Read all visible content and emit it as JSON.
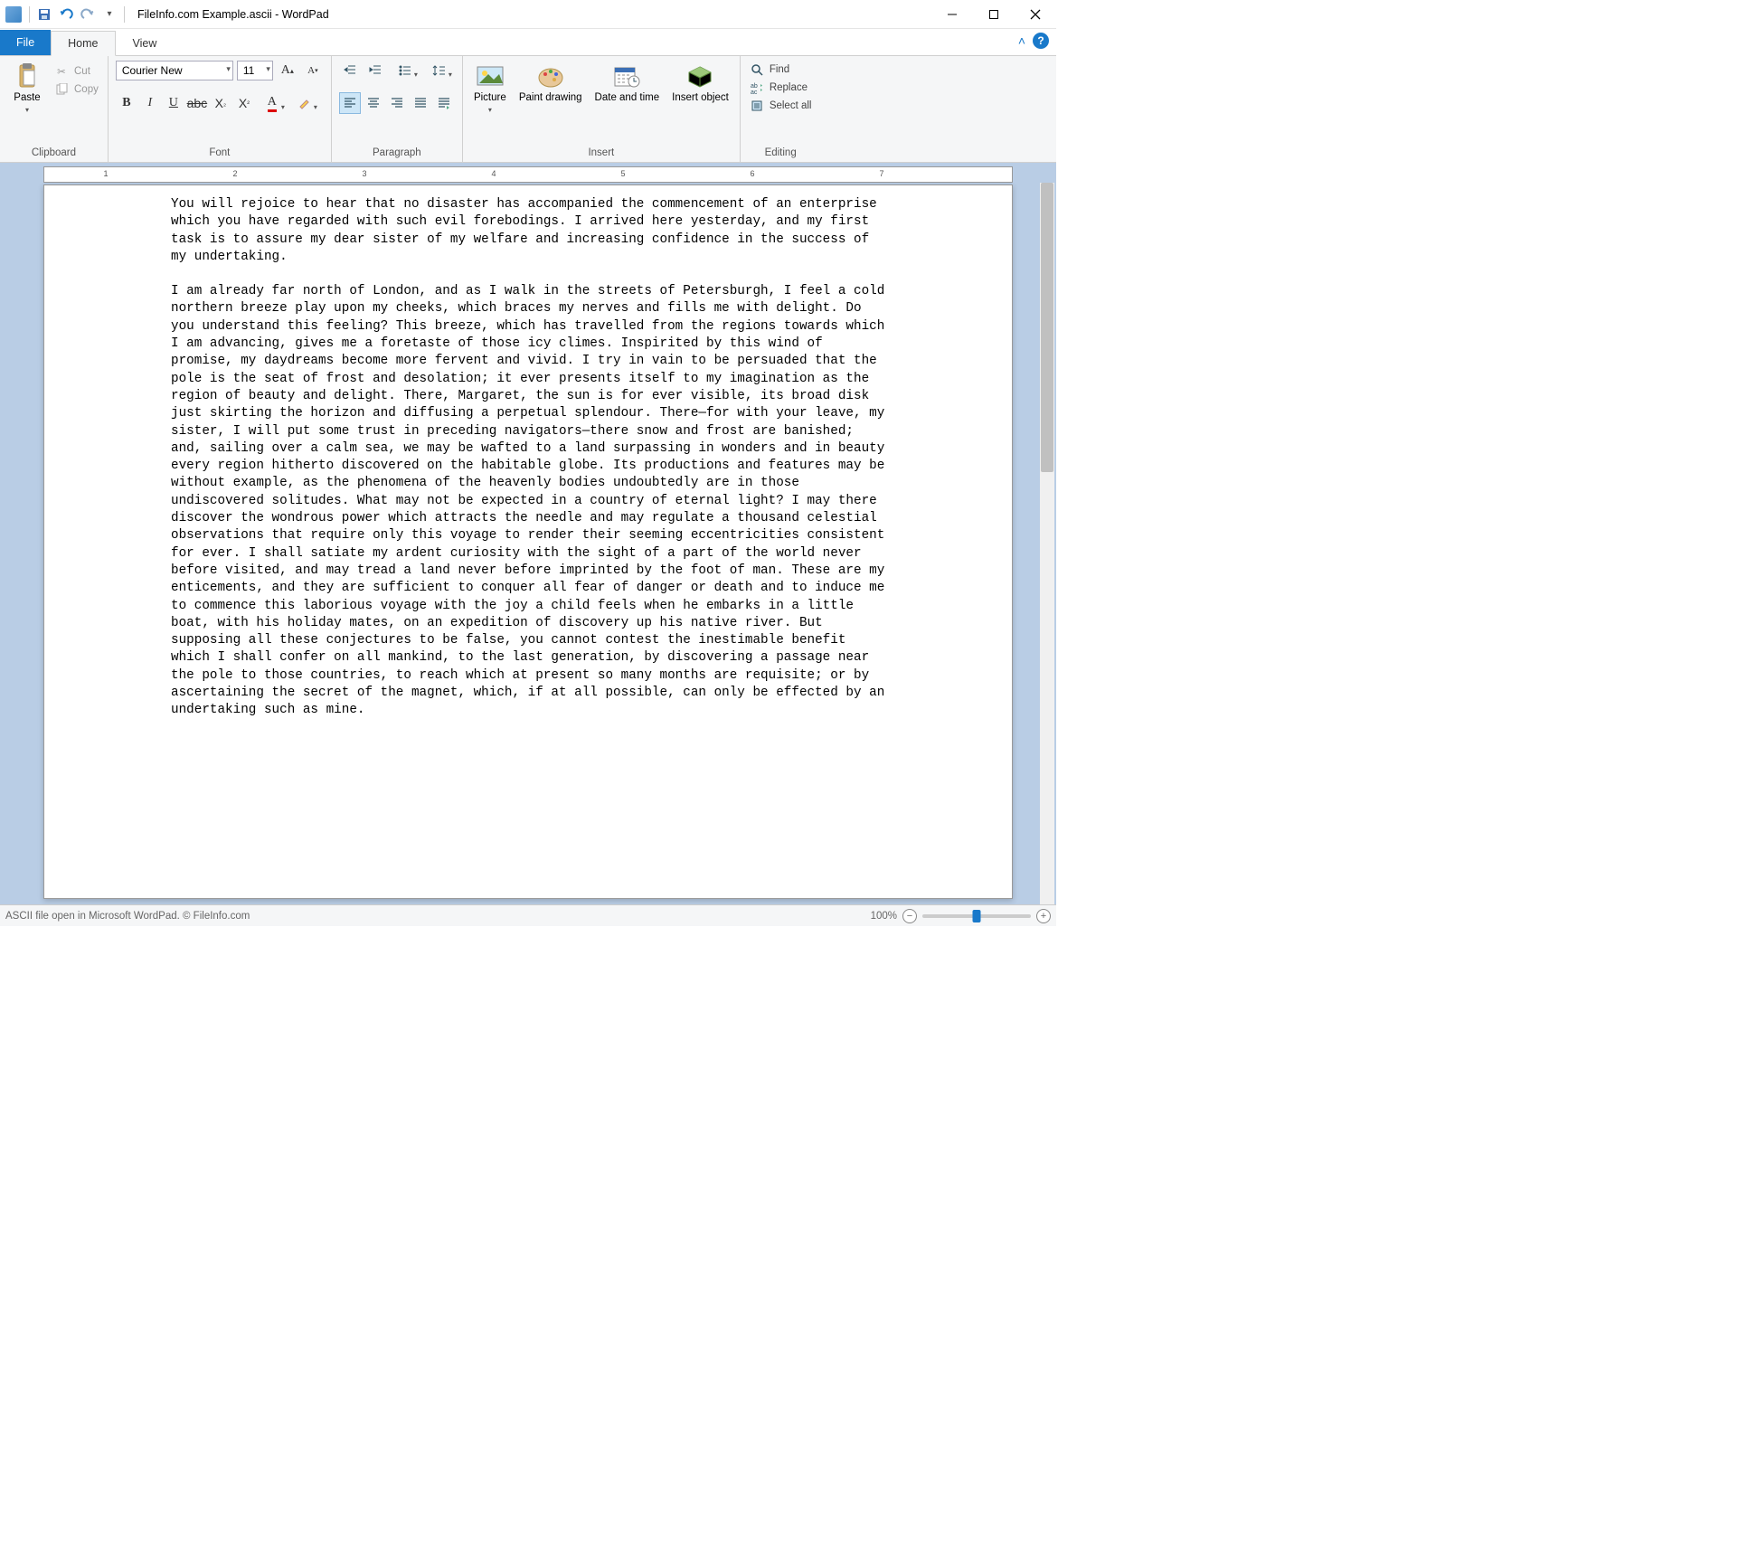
{
  "window": {
    "title": "FileInfo.com Example.ascii - WordPad"
  },
  "qat": {
    "save": "Save",
    "undo": "Undo",
    "redo": "Redo"
  },
  "tabs": {
    "file": "File",
    "home": "Home",
    "view": "View"
  },
  "ribbon": {
    "clipboard": {
      "label": "Clipboard",
      "paste": "Paste",
      "cut": "Cut",
      "copy": "Copy"
    },
    "font": {
      "label": "Font",
      "name": "Courier New",
      "size": "11"
    },
    "paragraph": {
      "label": "Paragraph"
    },
    "insert": {
      "label": "Insert",
      "picture": "Picture",
      "paint": "Paint drawing",
      "datetime": "Date and time",
      "object": "Insert object"
    },
    "editing": {
      "label": "Editing",
      "find": "Find",
      "replace": "Replace",
      "selectall": "Select all"
    }
  },
  "ruler": {
    "marks": [
      "1",
      "2",
      "3",
      "4",
      "5",
      "6",
      "7"
    ]
  },
  "document": {
    "p1": "You will rejoice to hear that no disaster has accompanied the commencement of an enterprise which you have regarded with such evil forebodings. I arrived here yesterday, and my first task is to assure my dear sister of my welfare and increasing confidence in the success of my undertaking.",
    "p2": "I am already far north of London, and as I walk in the streets of Petersburgh, I feel a cold northern breeze play upon my cheeks, which braces my nerves and fills me with delight. Do you understand this feeling? This breeze, which has travelled from the regions towards which I am advancing, gives me a foretaste of those icy climes. Inspirited by this wind of promise, my daydreams become more fervent and vivid. I try in vain to be persuaded that the pole is the seat of frost and desolation; it ever presents itself to my imagination as the region of beauty and delight. There, Margaret, the sun is for ever visible, its broad disk just skirting the horizon and diffusing a perpetual splendour. There—for with your leave, my sister, I will put some trust in preceding navigators—there snow and frost are banished; and, sailing over a calm sea, we may be wafted to a land surpassing in wonders and in beauty every region hitherto discovered on the habitable globe. Its productions and features may be without example, as the phenomena of the heavenly bodies undoubtedly are in those undiscovered solitudes. What may not be expected in a country of eternal light? I may there discover the wondrous power which attracts the needle and may regulate a thousand celestial observations that require only this voyage to render their seeming eccentricities consistent for ever. I shall satiate my ardent curiosity with the sight of a part of the world never before visited, and may tread a land never before imprinted by the foot of man. These are my enticements, and they are sufficient to conquer all fear of danger or death and to induce me to commence this laborious voyage with the joy a child feels when he embarks in a little boat, with his holiday mates, on an expedition of discovery up his native river. But supposing all these conjectures to be false, you cannot contest the inestimable benefit which I shall confer on all mankind, to the last generation, by discovering a passage near the pole to those countries, to reach which at present so many months are requisite; or by ascertaining the secret of the magnet, which, if at all possible, can only be effected by an undertaking such as mine."
  },
  "statusbar": {
    "text": "ASCII file open in Microsoft WordPad. © FileInfo.com",
    "zoom": "100%"
  }
}
